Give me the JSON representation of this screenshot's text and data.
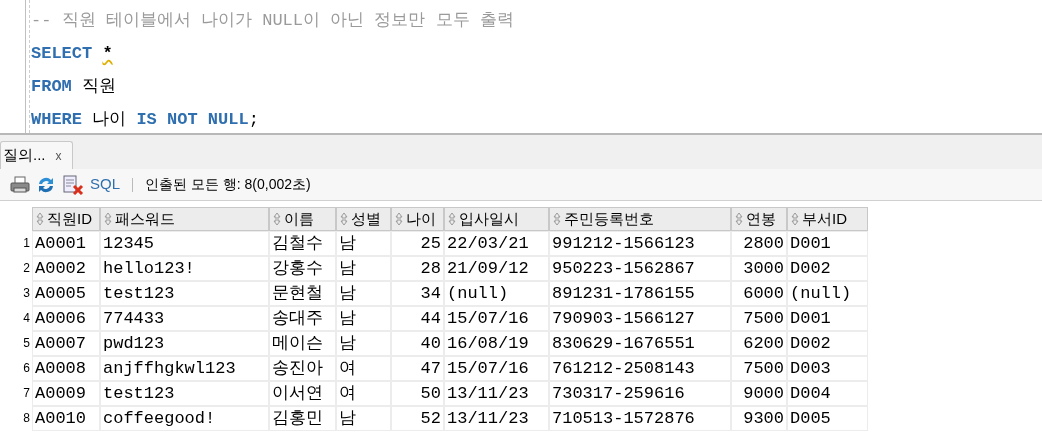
{
  "editor": {
    "lines": [
      [
        {
          "kind": "comment",
          "text": "-- 직원 테이블에서 나이가 NULL이 아닌 정보만 모두 출력"
        }
      ],
      [
        {
          "kind": "keyword",
          "text": "SELECT"
        },
        {
          "kind": "symbol",
          "text": "*",
          "warning": true
        }
      ],
      [
        {
          "kind": "keyword",
          "text": "FROM"
        },
        {
          "kind": "plain",
          "text": " 직원"
        }
      ],
      [
        {
          "kind": "keyword",
          "text": "WHERE"
        },
        {
          "kind": "plain",
          "text": " 나이 "
        },
        {
          "kind": "keyword",
          "text": "IS NOT NULL"
        },
        {
          "kind": "plain",
          "text": ";"
        }
      ]
    ]
  },
  "result_tab": {
    "label": "질의...",
    "close": "x",
    "selected": true
  },
  "toolbar": {
    "sql_label": "SQL",
    "status": "인출된 모든 행: 8(0,002초)"
  },
  "table": {
    "columns": [
      {
        "label": "직원ID"
      },
      {
        "label": "패스워드"
      },
      {
        "label": "이름"
      },
      {
        "label": "성별"
      },
      {
        "label": "나이"
      },
      {
        "label": "입사일시"
      },
      {
        "label": "주민등록번호"
      },
      {
        "label": "연봉"
      },
      {
        "label": "부서ID"
      }
    ],
    "rows": [
      {
        "number": "1",
        "cells": [
          "A0001",
          "12345",
          "김철수",
          "남",
          "25",
          "22/03/21",
          "991212-1566123",
          "2800",
          "D001"
        ]
      },
      {
        "number": "2",
        "cells": [
          "A0002",
          "hello123!",
          "강홍수",
          "남",
          "28",
          "21/09/12",
          "950223-1562867",
          "3000",
          "D002"
        ]
      },
      {
        "number": "3",
        "cells": [
          "A0005",
          "test123",
          "문현철",
          "남",
          "34",
          "(null)",
          "891231-1786155",
          "6000",
          "(null)"
        ]
      },
      {
        "number": "4",
        "cells": [
          "A0006",
          "774433",
          "송대주",
          "남",
          "44",
          "15/07/16",
          "790903-1566127",
          "7500",
          "D001"
        ]
      },
      {
        "number": "5",
        "cells": [
          "A0007",
          "pwd123",
          "메이슨",
          "남",
          "40",
          "16/08/19",
          "830629-1676551",
          "6200",
          "D002"
        ]
      },
      {
        "number": "6",
        "cells": [
          "A0008",
          "anjffhgkwl123",
          "송진아",
          "여",
          "47",
          "15/07/16",
          "761212-2508143",
          "7500",
          "D003"
        ]
      },
      {
        "number": "7",
        "cells": [
          "A0009",
          "test123",
          "이서연",
          "여",
          "50",
          "13/11/23",
          "730317-259616",
          "9000",
          "D004"
        ]
      },
      {
        "number": "8",
        "cells": [
          "A0010",
          "coffeegood!",
          "김홍민",
          "남",
          "52",
          "13/11/23",
          "710513-1572876",
          "9300",
          "D005"
        ]
      }
    ]
  }
}
